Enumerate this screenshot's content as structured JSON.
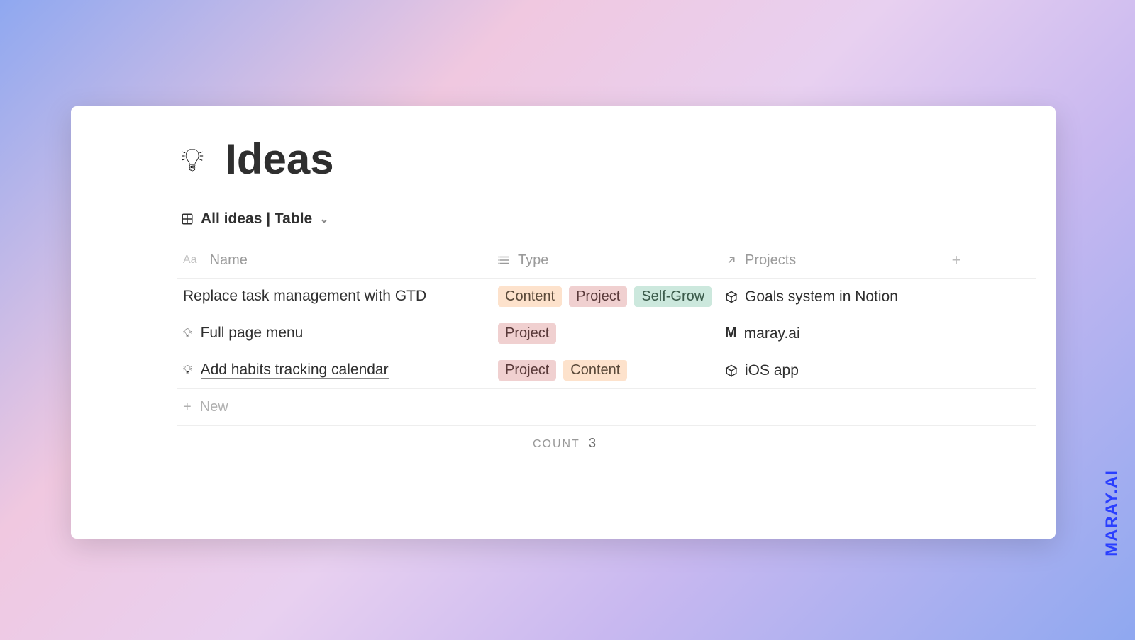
{
  "page": {
    "icon": "lightbulb",
    "title": "Ideas"
  },
  "view": {
    "label": "All ideas | Table"
  },
  "columns": {
    "name": "Name",
    "type": "Type",
    "projects": "Projects"
  },
  "rows": [
    {
      "icon": "none",
      "name": "Replace task management with GTD",
      "tags": [
        {
          "label": "Content",
          "variant": "content"
        },
        {
          "label": "Project",
          "variant": "project"
        },
        {
          "label": "Self-Grow",
          "variant": "selfgrow"
        }
      ],
      "project": {
        "icon": "cube",
        "label": "Goals system in Notion"
      }
    },
    {
      "icon": "idea",
      "name": "Full page menu",
      "tags": [
        {
          "label": "Project",
          "variant": "project"
        }
      ],
      "project": {
        "icon": "M",
        "label": "maray.ai"
      }
    },
    {
      "icon": "idea",
      "name": "Add habits tracking calendar",
      "tags": [
        {
          "label": "Project",
          "variant": "project"
        },
        {
          "label": "Content",
          "variant": "content"
        }
      ],
      "project": {
        "icon": "cube",
        "label": "iOS app"
      }
    }
  ],
  "newRowLabel": "New",
  "footer": {
    "countLabel": "COUNT",
    "countValue": "3"
  },
  "watermark": "MARAY.AI",
  "tagColors": {
    "content": "tag-content",
    "project": "tag-project",
    "selfgrow": "tag-selfgrow"
  }
}
